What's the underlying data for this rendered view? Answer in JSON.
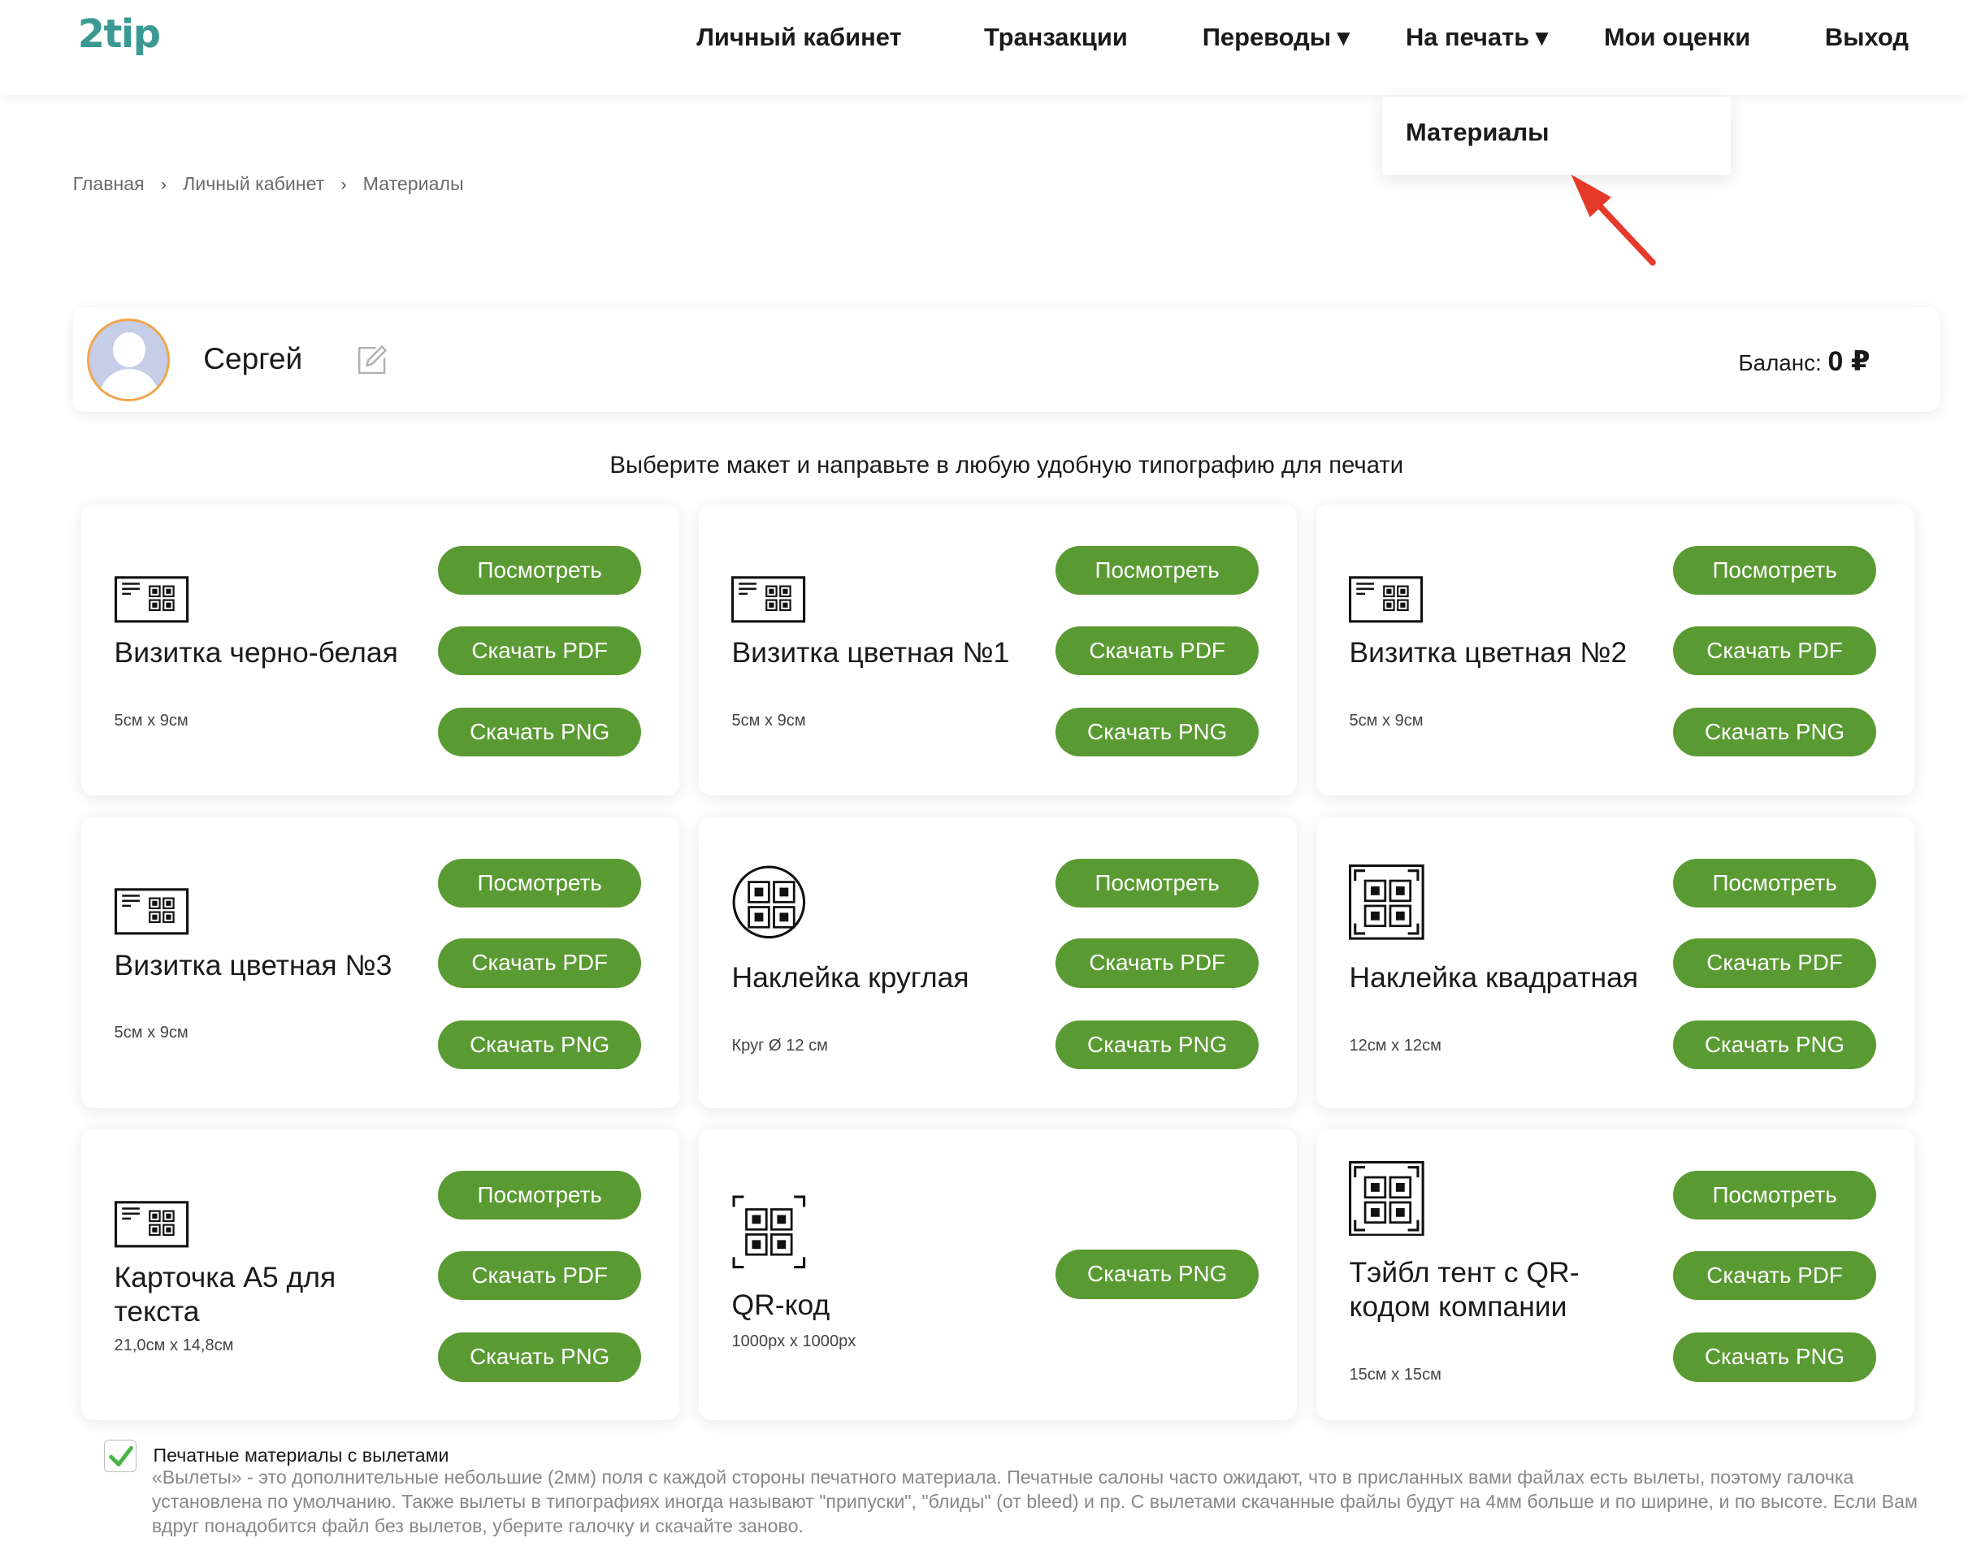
{
  "header": {
    "logo_text_a": "2",
    "logo_text_b": "tip",
    "nav": [
      {
        "label": "Личный кабинет"
      },
      {
        "label": "Транзакции"
      },
      {
        "label": "Переводы",
        "caret": "▼"
      },
      {
        "label": "На печать",
        "caret": "▼"
      },
      {
        "label": "Мои оценки"
      },
      {
        "label": "Выход"
      }
    ],
    "dropdown": {
      "items": [
        "Материалы"
      ]
    }
  },
  "breadcrumb": [
    "Главная",
    "Личный кабинет",
    "Материалы"
  ],
  "breadcrumb_sep": "›",
  "profile": {
    "name": "Сергей",
    "balance_label": "Баланс:",
    "balance_value": "0 ₽"
  },
  "intro": "Выберите макет и направьте в любую удобную типографию для печати",
  "buttons": {
    "view": "Посмотреть",
    "pdf": "Скачать PDF",
    "png": "Скачать PNG"
  },
  "cards": [
    {
      "title": "Визитка черно-белая",
      "sub": "5см х 9см",
      "icon": "business-card-icon"
    },
    {
      "title": "Визитка цветная №1",
      "sub": "5см х 9см",
      "icon": "business-card-icon"
    },
    {
      "title": "Визитка цветная №2",
      "sub": "5см х 9см",
      "icon": "business-card-icon"
    },
    {
      "title": "Визитка цветная №3",
      "sub": "5см х 9см",
      "icon": "business-card-icon"
    },
    {
      "title": "Наклейка круглая",
      "sub": "Круг Ø 12 см",
      "icon": "round-sticker-icon"
    },
    {
      "title": "Наклейка квадратная",
      "sub": "12см х 12см",
      "icon": "square-sticker-icon"
    },
    {
      "title": "Карточка А5 для текста",
      "sub": "21,0см х 14,8см",
      "icon": "business-card-icon"
    },
    {
      "title": "QR-код",
      "sub": "1000px х 1000px",
      "icon": "qr-code-icon"
    },
    {
      "title": "Тэйбл тент с QR-кодом компании",
      "sub": "15см х 15см",
      "icon": "square-sticker-icon"
    }
  ],
  "bleed": {
    "checked": true,
    "label": "Печатные материалы с вылетами",
    "description": "«Вылеты» - это дополнительные небольшие (2мм) поля с каждой стороны печатного материала. Печатные салоны часто ожидают, что в присланных вами файлах есть вылеты, поэтому галочка установлена по умолчанию. Также вылеты в типографиях иногда называют \"припуски\", \"блиды\" (от bleed) и пр. С вылетами скачанные файлы будут на 4мм больше и по ширине, и по высоте. Если Вам вдруг понадобится файл без вылетов, уберите галочку и скачайте заново."
  },
  "colors": {
    "accent_green": "#5a9a32",
    "logo_teal": "#3a9a93",
    "arrow_red": "#e53a2a",
    "avatar_ring": "#f0a64a"
  }
}
